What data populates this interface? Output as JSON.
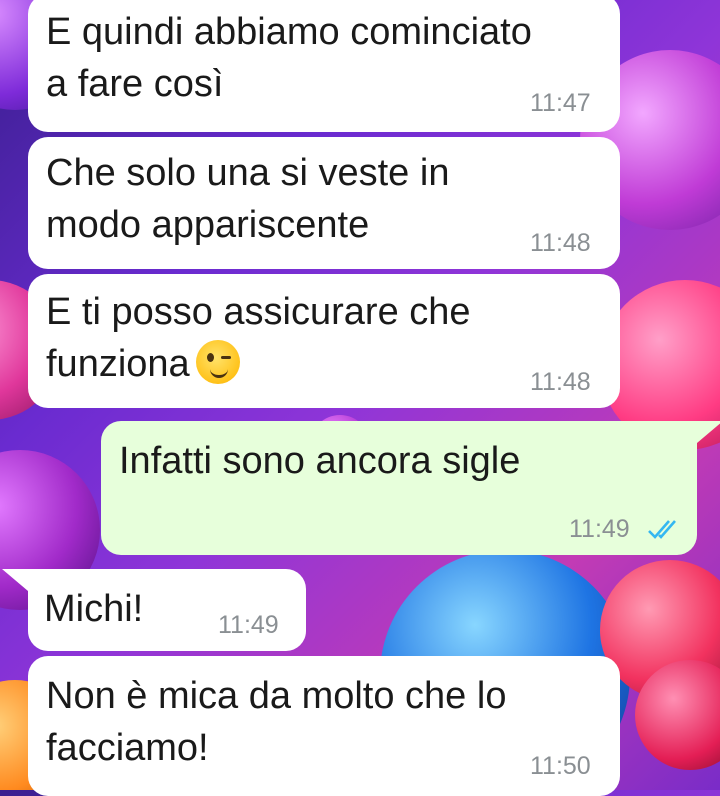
{
  "colors": {
    "incoming_bubble": "#ffffff",
    "outgoing_bubble": "#e7ffdb",
    "timestamp": "#8a8f93",
    "read_ticks": "#34b7f1"
  },
  "messages": [
    {
      "direction": "incoming",
      "line1": "E quindi abbiamo cominciato",
      "line2": "a fare così",
      "time": "11:47"
    },
    {
      "direction": "incoming",
      "line1": "Che solo una si veste in",
      "line2": "modo appariscente",
      "time": "11:48"
    },
    {
      "direction": "incoming",
      "line1": "E ti posso assicurare che",
      "line2": "funziona",
      "emoji": "winking-face",
      "time": "11:48"
    },
    {
      "direction": "outgoing",
      "line1": "Infatti sono ancora sigle",
      "time": "11:49",
      "status": "read-double-check"
    },
    {
      "direction": "incoming",
      "line1": "Michi!",
      "time": "11:49"
    },
    {
      "direction": "incoming",
      "line1": "Non è mica da molto che lo",
      "line2": "facciamo!",
      "time": "11:50"
    }
  ]
}
